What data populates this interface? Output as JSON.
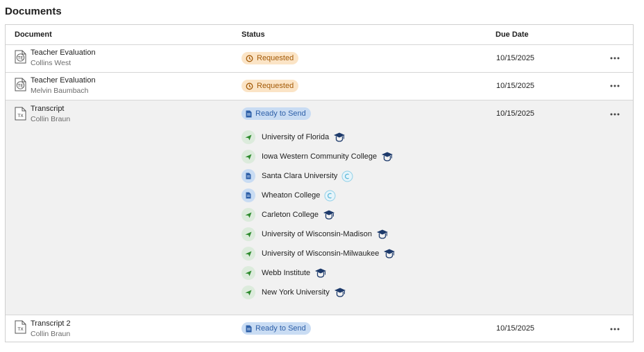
{
  "page": {
    "title": "Documents"
  },
  "table": {
    "headers": {
      "document": "Document",
      "status": "Status",
      "due_date": "Due Date"
    },
    "rows": [
      {
        "doc_type": "teacher-evaluation",
        "icon_text": "TE",
        "name": "Teacher Evaluation",
        "person": "Collins West",
        "status": "Requested",
        "due": "10/15/2025"
      },
      {
        "doc_type": "teacher-evaluation",
        "icon_text": "TE",
        "name": "Teacher Evaluation",
        "person": "Melvin Baumbach",
        "status": "Requested",
        "due": "10/15/2025"
      },
      {
        "doc_type": "transcript",
        "icon_text": "TX",
        "name": "Transcript",
        "person": "Collin Braun",
        "status": "Ready to Send",
        "due": "10/15/2025",
        "colleges": [
          {
            "name": "University of Florida",
            "state": "sent",
            "badge": "graduation-cap-icon"
          },
          {
            "name": "Iowa Western Community College",
            "state": "sent",
            "badge": "graduation-cap-icon"
          },
          {
            "name": "Santa Clara University",
            "state": "ready",
            "badge": "common-app-icon"
          },
          {
            "name": "Wheaton College",
            "state": "ready",
            "badge": "common-app-icon"
          },
          {
            "name": "Carleton College",
            "state": "sent",
            "badge": "graduation-cap-icon"
          },
          {
            "name": "University of Wisconsin-Madison",
            "state": "sent",
            "badge": "graduation-cap-icon"
          },
          {
            "name": "University of Wisconsin-Milwaukee",
            "state": "sent",
            "badge": "graduation-cap-icon"
          },
          {
            "name": "Webb Institute",
            "state": "sent",
            "badge": "graduation-cap-icon"
          },
          {
            "name": "New York University",
            "state": "sent",
            "badge": "graduation-cap-icon"
          }
        ]
      },
      {
        "doc_type": "transcript",
        "icon_text": "TX",
        "name": "Transcript 2",
        "person": "Collin Braun",
        "status": "Ready to Send",
        "due": "10/15/2025"
      }
    ]
  },
  "colors": {
    "requested_bg": "#fbe4c6",
    "requested_text": "#a35a07",
    "ready_bg": "#c9dcf3",
    "ready_text": "#2d5fa8",
    "sent_arrow": "#2e8b2e",
    "cap": "#1d3a6b"
  }
}
